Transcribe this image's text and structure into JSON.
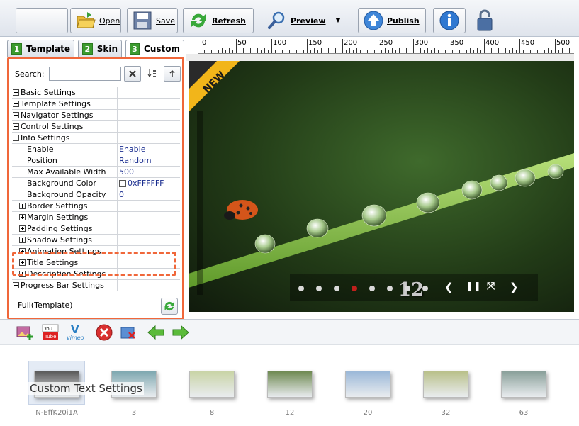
{
  "toolbar": {
    "open_label": "Open",
    "save_label": "Save",
    "refresh_label": "Refresh",
    "preview_label": "Preview",
    "publish_label": "Publish"
  },
  "tabs": [
    {
      "num": "1",
      "label": "Template"
    },
    {
      "num": "2",
      "label": "Skin"
    },
    {
      "num": "3",
      "label": "Custom"
    }
  ],
  "search": {
    "label": "Search:",
    "value": ""
  },
  "properties": [
    {
      "key": "Basic Settings",
      "value": "",
      "level": 0,
      "expander": "plus"
    },
    {
      "key": "Template Settings",
      "value": "",
      "level": 0,
      "expander": "plus"
    },
    {
      "key": "Navigator Settings",
      "value": "",
      "level": 0,
      "expander": "plus"
    },
    {
      "key": "Control Settings",
      "value": "",
      "level": 0,
      "expander": "plus"
    },
    {
      "key": "Info Settings",
      "value": "",
      "level": 0,
      "expander": "minus"
    },
    {
      "key": "Enable",
      "value": "Enable",
      "level": 2,
      "expander": ""
    },
    {
      "key": "Position",
      "value": "Random",
      "level": 2,
      "expander": ""
    },
    {
      "key": "Max Available Width",
      "value": "500",
      "level": 2,
      "expander": ""
    },
    {
      "key": "Background Color",
      "value": "0xFFFFFF",
      "level": 2,
      "expander": "",
      "swatch": "#FFFFFF"
    },
    {
      "key": "Background Opacity",
      "value": "0",
      "level": 2,
      "expander": ""
    },
    {
      "key": "Border Settings",
      "value": "",
      "level": 1,
      "expander": "plus"
    },
    {
      "key": "Margin Settings",
      "value": "",
      "level": 1,
      "expander": "plus"
    },
    {
      "key": "Padding Settings",
      "value": "",
      "level": 1,
      "expander": "plus"
    },
    {
      "key": "Shadow Settings",
      "value": "",
      "level": 1,
      "expander": "plus"
    },
    {
      "key": "Animation Settings",
      "value": "",
      "level": 1,
      "expander": "plus"
    },
    {
      "key": "Title Settings",
      "value": "",
      "level": 1,
      "expander": "plus"
    },
    {
      "key": "Description Settings",
      "value": "",
      "level": 1,
      "expander": "plus"
    },
    {
      "key": "Progress Bar Settings",
      "value": "",
      "level": 0,
      "expander": "plus"
    }
  ],
  "template_name": "Full(Template)",
  "ruler_labels": [
    "0",
    "50",
    "100",
    "150",
    "200",
    "250",
    "300",
    "350",
    "400",
    "450",
    "500"
  ],
  "preview": {
    "badge": "NEW",
    "slide_number": "12",
    "dot_count": 8,
    "active_dot": 3
  },
  "thumbnails": [
    {
      "label": "N-EffK20i1A"
    },
    {
      "label": "3"
    },
    {
      "label": "8"
    },
    {
      "label": "12"
    },
    {
      "label": "20"
    },
    {
      "label": "32"
    },
    {
      "label": "63"
    }
  ],
  "overlay_text": "Custom Text Settings",
  "colors": {
    "highlight": "#F0673A",
    "value_text": "#1A2D8F",
    "tab_number": "#3B9B2E",
    "active_dot": "#C0201C"
  }
}
